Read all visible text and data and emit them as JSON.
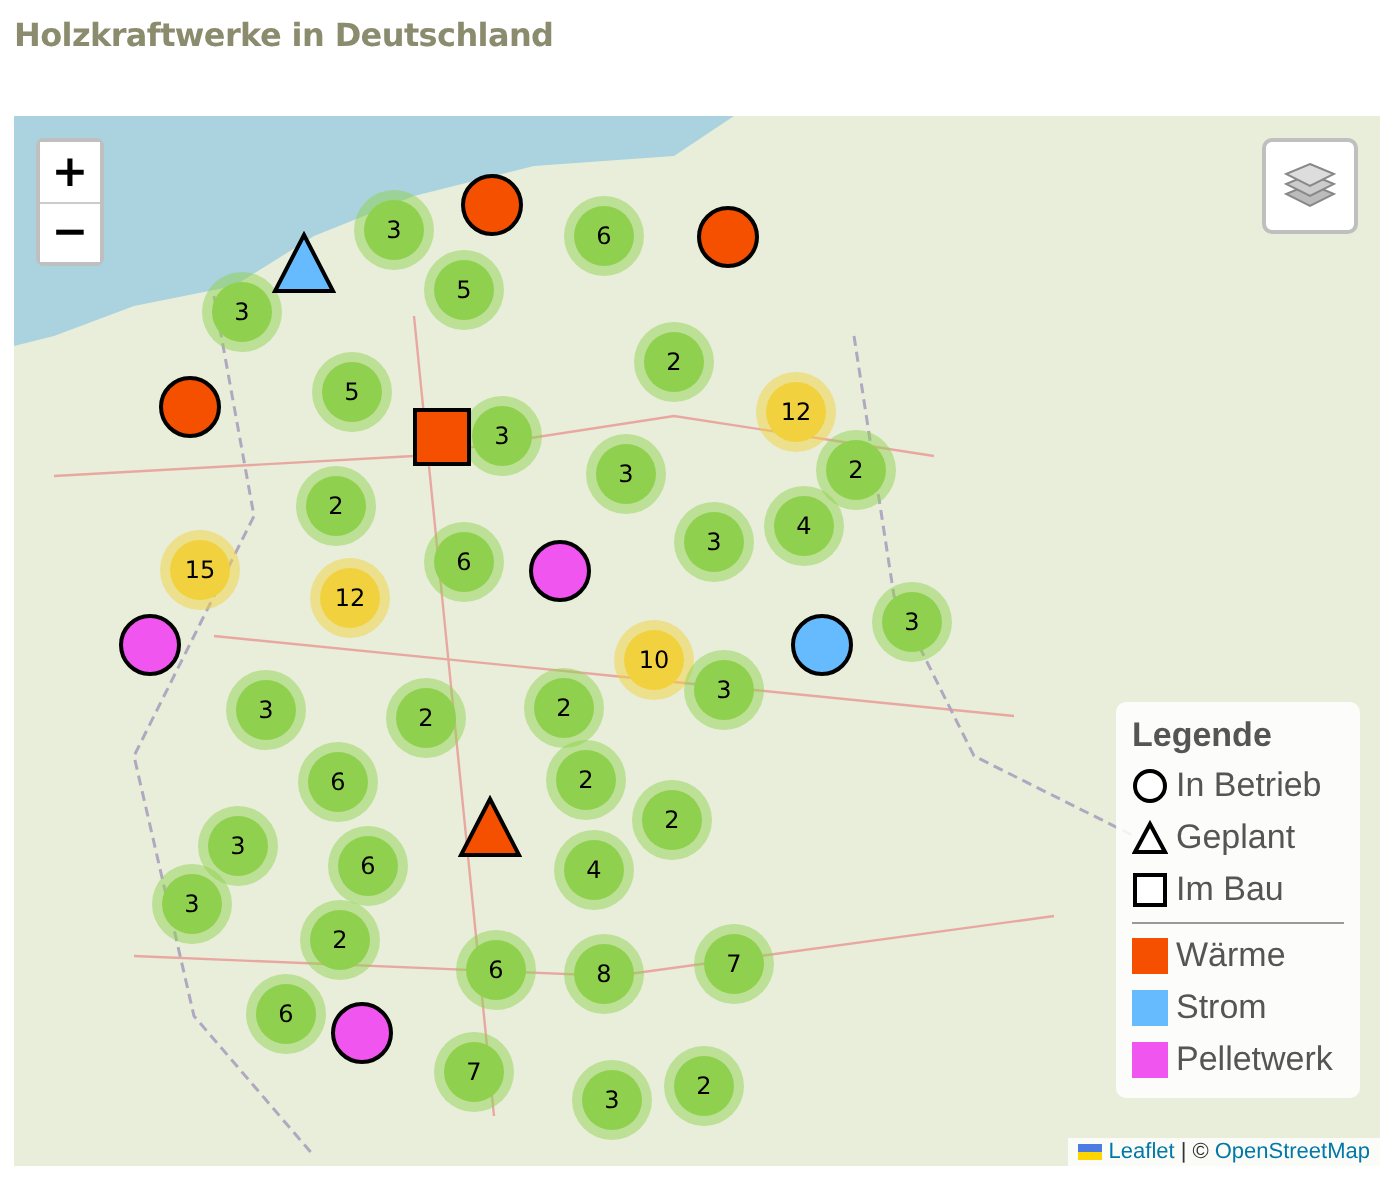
{
  "title": "Holzkraftwerke in Deutschland",
  "map": {
    "zoom_in": "+",
    "zoom_out": "−",
    "clusters": [
      {
        "count": "3",
        "color": "#8fd14f"
      },
      {
        "count": "6",
        "color": "#8fd14f"
      },
      {
        "count": "5",
        "color": "#8fd14f"
      },
      {
        "count": "3",
        "color": "#8fd14f"
      },
      {
        "count": "2",
        "color": "#8fd14f"
      },
      {
        "count": "5",
        "color": "#8fd14f"
      },
      {
        "count": "12",
        "color": "#f1d23e"
      },
      {
        "count": "3",
        "color": "#8fd14f"
      },
      {
        "count": "2",
        "color": "#8fd14f"
      },
      {
        "count": "3",
        "color": "#8fd14f"
      },
      {
        "count": "2",
        "color": "#8fd14f"
      },
      {
        "count": "3",
        "color": "#8fd14f"
      },
      {
        "count": "4",
        "color": "#8fd14f"
      },
      {
        "count": "6",
        "color": "#8fd14f"
      },
      {
        "count": "15",
        "color": "#f1d23e"
      },
      {
        "count": "12",
        "color": "#f1d23e"
      },
      {
        "count": "3",
        "color": "#8fd14f"
      },
      {
        "count": "10",
        "color": "#f1d23e"
      },
      {
        "count": "3",
        "color": "#8fd14f"
      },
      {
        "count": "2",
        "color": "#8fd14f"
      },
      {
        "count": "2",
        "color": "#8fd14f"
      },
      {
        "count": "3",
        "color": "#8fd14f"
      },
      {
        "count": "6",
        "color": "#8fd14f"
      },
      {
        "count": "2",
        "color": "#8fd14f"
      },
      {
        "count": "3",
        "color": "#8fd14f"
      },
      {
        "count": "6",
        "color": "#8fd14f"
      },
      {
        "count": "2",
        "color": "#8fd14f"
      },
      {
        "count": "4",
        "color": "#8fd14f"
      },
      {
        "count": "3",
        "color": "#8fd14f"
      },
      {
        "count": "2",
        "color": "#8fd14f"
      },
      {
        "count": "6",
        "color": "#8fd14f"
      },
      {
        "count": "8",
        "color": "#8fd14f"
      },
      {
        "count": "7",
        "color": "#8fd14f"
      },
      {
        "count": "6",
        "color": "#8fd14f"
      },
      {
        "count": "7",
        "color": "#8fd14f"
      },
      {
        "count": "3",
        "color": "#8fd14f"
      },
      {
        "count": "2",
        "color": "#8fd14f"
      }
    ],
    "markers": [
      {
        "kind": "circle",
        "color": "#f54f00"
      },
      {
        "kind": "circle",
        "color": "#f54f00"
      },
      {
        "kind": "triangle",
        "color": "#66bbff"
      },
      {
        "kind": "circle",
        "color": "#f54f00"
      },
      {
        "kind": "square",
        "color": "#f54f00"
      },
      {
        "kind": "circle",
        "color": "#f055f0"
      },
      {
        "kind": "circle",
        "color": "#f055f0"
      },
      {
        "kind": "circle",
        "color": "#66bbff"
      },
      {
        "kind": "triangle",
        "color": "#f54f00"
      },
      {
        "kind": "circle",
        "color": "#f055f0"
      }
    ],
    "legend": {
      "title": "Legende",
      "shapes": [
        {
          "kind": "circle",
          "label": "In Betrieb"
        },
        {
          "kind": "triangle",
          "label": "Geplant"
        },
        {
          "kind": "square",
          "label": "Im Bau"
        }
      ],
      "colors": [
        {
          "color": "#f54f00",
          "label": "Wärme"
        },
        {
          "color": "#66bbff",
          "label": "Strom"
        },
        {
          "color": "#f055f0",
          "label": "Pelletwerk"
        }
      ]
    },
    "attribution": {
      "link": "Leaflet",
      "separator": "| ©",
      "source": "OpenStreetMap"
    }
  }
}
